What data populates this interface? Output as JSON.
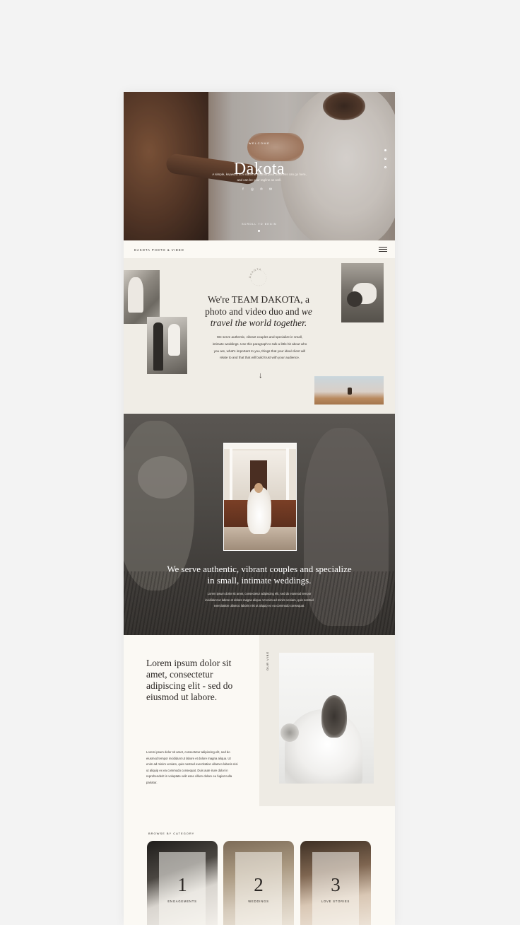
{
  "hero": {
    "welcome": "WELCOME",
    "title": "Dakota",
    "tagline": "A simple, keyword rich statement about your business can go here, and can be your tagline as well.",
    "socials": [
      "f",
      "◎",
      "℗",
      "✉"
    ],
    "scroll": "SCROLL TO BEGIN"
  },
  "nav": {
    "brand": "DAKOTA PHOTO & VIDEO"
  },
  "intro": {
    "stamp_text": "DAKOTA",
    "heading_a": "We're TEAM DAKOTA, a photo and video duo and ",
    "heading_b": "we travel the world together.",
    "body": "We serve authentic, vibrant couples and specialize in small, intimate weddings. Use this paragraph to talk a little bit about who you are, what's important to you, things that your ideal client will relate to and that that will build trust with your audience.",
    "arrow": "↓"
  },
  "dark": {
    "heading": "We serve authentic, vibrant couples and specialize in small, intimate weddings.",
    "body": "Lorem ipsum dolor sit amet, consectetur adipiscing elit, sed do eiusmod tempor incididunt ut labore et dolore magna aliqua. Ut enim ad minim veniam, quis nostrud exercitation ullamco laboris nisi ut aliquip ex ea commodo consequat."
  },
  "vibe": {
    "label": "OUR VIBE",
    "heading": "Lorem ipsum dolor sit amet, consectetur adipiscing elit - sed do eiusmod ut labore.",
    "body": "Lorem ipsum dolor sit amet, consectetur adipiscing elit, sed do eiusmod tempor incididunt ut labore et dolore magna aliqua. Ut enim ad minim veniam, quis nostrud exercitation ullamco laboris nisi ut aliquip ex ea commodo consequat. Duis aute irure dolor in reprehenderit in voluptate velit esse cillum dolore eu fugiat nulla pariatur."
  },
  "browse": {
    "label": "BROWSE BY CATEGORY",
    "categories": [
      {
        "num": "1",
        "label": "ENGAGEMENTS"
      },
      {
        "num": "2",
        "label": "WEDDINGS"
      },
      {
        "num": "3",
        "label": "LOVE STORIES"
      }
    ]
  }
}
